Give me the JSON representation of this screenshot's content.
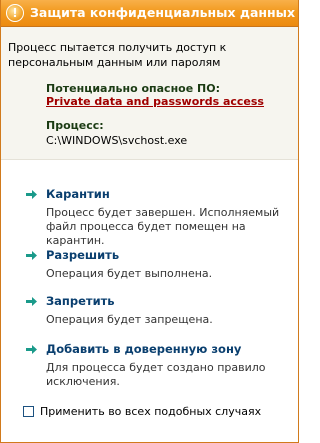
{
  "window": {
    "title": "Защита конфиденциальных данных",
    "title_icon_glyph": "!"
  },
  "alert": {
    "description": "Процесс пытается получить доступ к персональным данным или паролям",
    "threat_label": "Потенциально опасное ПО:",
    "threat_name": "Private data and passwords access",
    "process_label": "Процесс:",
    "process_path": "C:\\WINDOWS\\svchost.exe"
  },
  "actions": [
    {
      "title": "Карантин",
      "description": "Процесс будет завершен. Исполняемый файл процесса будет помещен на карантин."
    },
    {
      "title": "Разрешить",
      "description": "Операция будет выполнена."
    },
    {
      "title": "Запретить",
      "description": "Операция будет запрещена."
    },
    {
      "title": "Добавить в доверенную зону",
      "description": "Для процесса будет создано правило исключения."
    }
  ],
  "apply_all": {
    "label": "Применить во всех подобных случаях",
    "checked": false
  },
  "colors": {
    "titlebar": "#f29a1f",
    "threat_link": "#a00000",
    "action_link": "#0a3f6f",
    "arrow": "#1a9a8a"
  }
}
